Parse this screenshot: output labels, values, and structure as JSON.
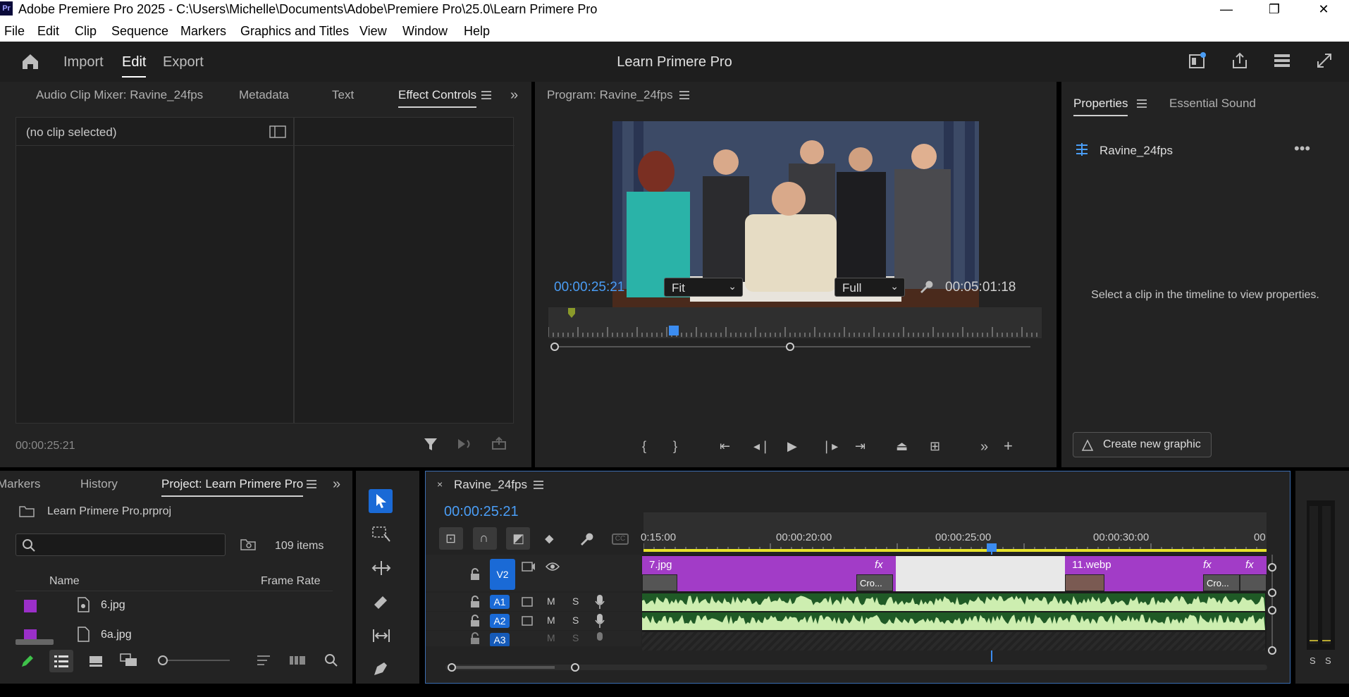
{
  "window": {
    "app_icon": "Pr",
    "title": "Adobe Premiere Pro 2025 - C:\\Users\\Michelle\\Documents\\Adobe\\Premiere Pro\\25.0\\Learn Primere Pro",
    "minimize": "—",
    "maximize": "❐",
    "close": "✕"
  },
  "menu": [
    "File",
    "Edit",
    "Clip",
    "Sequence",
    "Markers",
    "Graphics and Titles",
    "View",
    "Window",
    "Help"
  ],
  "header": {
    "nav": [
      "Import",
      "Edit",
      "Export"
    ],
    "project_title": "Learn Primere Pro"
  },
  "source_panel": {
    "tabs": [
      "Audio Clip Mixer: Ravine_24fps",
      "Metadata",
      "Text",
      "Effect Controls"
    ],
    "no_clip": "(no clip selected)",
    "timecode": "00:00:25:21"
  },
  "program_monitor": {
    "tab": "Program: Ravine_24fps",
    "timecode": "00:00:25:21",
    "fit": "Fit",
    "quality": "Full",
    "duration": "00:05:01:18"
  },
  "properties": {
    "tabs": [
      "Properties",
      "Essential Sound"
    ],
    "clip_name": "Ravine_24fps",
    "message": "Select a clip in the timeline to view properties.",
    "create_graphic": "Create new graphic"
  },
  "project_panel": {
    "tabs": [
      "Markers",
      "History",
      "Project: Learn Primere Pro"
    ],
    "project_file": "Learn Primere Pro.prproj",
    "item_count": "109 items",
    "columns": [
      "Name",
      "Frame Rate"
    ],
    "rows": [
      {
        "name": "6.jpg",
        "color": "#9b2fc9"
      },
      {
        "name": "6a.jpg",
        "color": "#9b2fc9"
      }
    ]
  },
  "timeline": {
    "sequence": "Ravine_24fps",
    "timecode": "00:00:25:21",
    "ruler_labels": [
      "0:15:00",
      "00:00:20:00",
      "00:00:25:00",
      "00:00:30:00",
      "00:"
    ],
    "tracks": {
      "v2": "V2",
      "a1": "A1",
      "a2": "A2",
      "a3": "A3",
      "mute": "M",
      "solo": "S"
    },
    "clips": [
      {
        "name": "7.jpg",
        "fx": "fx",
        "sub": "Cro..."
      },
      {
        "name": "11.webp",
        "fx": "fx",
        "sub": "Cro..."
      }
    ],
    "meter_labels": [
      "S",
      "S"
    ]
  },
  "colors": {
    "accent_blue": "#4a9df5",
    "clip_purple": "#a23cc7",
    "audio_green": "#cdeeb0",
    "playhead": "#3b8cf0"
  }
}
